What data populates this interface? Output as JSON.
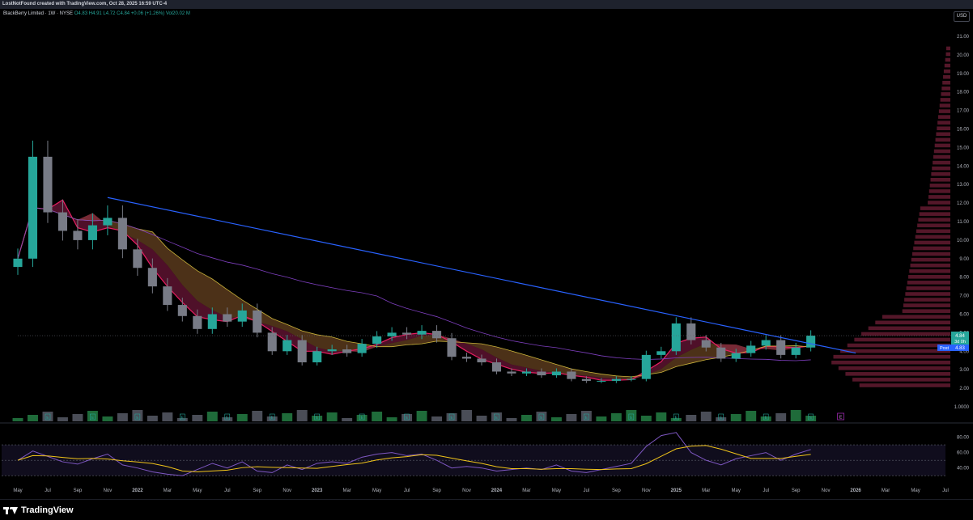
{
  "header": {
    "attribution": "LostNotFound created with TradingView.com, Oct 28, 2025 16:59 UTC-4"
  },
  "legend": {
    "symbol": "BlackBerry Limited · 1W · NYSE",
    "open": "O4.83",
    "high": "H4.91",
    "low": "L4.72",
    "close": "C4.84",
    "change": "+0.06 (+1.26%)",
    "volume": "Vol20.02 M"
  },
  "currency_button": "USD",
  "price_labels": {
    "last": "4.84",
    "countdown": "3d 0h",
    "post_tag": "Post",
    "post_value": "4.83"
  },
  "earnings_marker": "E",
  "brand": {
    "name": "TradingView"
  },
  "colors": {
    "up": "#26a69a",
    "down": "#787b86",
    "trendline": "#2962ff",
    "volume_profile": "#5d1a2e",
    "rsi": "#7e57c2",
    "rsi_ma": "#f0c419"
  },
  "chart_data": [
    {
      "type": "candlestick",
      "title": "BlackBerry Limited · 1W · NYSE",
      "x_ticks": [
        "May",
        "Jul",
        "Sep",
        "Nov",
        "2022",
        "Mar",
        "May",
        "Jul",
        "Sep",
        "Nov",
        "2023",
        "Mar",
        "May",
        "Jul",
        "Sep",
        "Nov",
        "2024",
        "Mar",
        "May",
        "Jul",
        "Sep",
        "Nov",
        "2025",
        "Mar",
        "May",
        "Jul",
        "Sep",
        "Nov",
        "2026",
        "Mar",
        "May",
        "Jul"
      ],
      "y_ticks": [
        "21.00",
        "20.00",
        "19.00",
        "18.00",
        "17.00",
        "16.00",
        "15.00",
        "14.00",
        "13.00",
        "12.00",
        "11.00",
        "10.00",
        "9.00",
        "8.00",
        "7.00",
        "6.00",
        "5.00",
        "4.00",
        "3.00",
        "2.00",
        "1.0000"
      ],
      "ylim": [
        1.0,
        21.0
      ],
      "x": [
        "2021-05",
        "2021-06",
        "2021-07",
        "2021-08",
        "2021-09",
        "2021-10",
        "2021-11",
        "2021-12",
        "2022-01",
        "2022-02",
        "2022-03",
        "2022-04",
        "2022-05",
        "2022-06",
        "2022-07",
        "2022-08",
        "2022-09",
        "2022-10",
        "2022-11",
        "2022-12",
        "2023-01",
        "2023-02",
        "2023-03",
        "2023-04",
        "2023-05",
        "2023-06",
        "2023-07",
        "2023-08",
        "2023-09",
        "2023-10",
        "2023-11",
        "2023-12",
        "2024-01",
        "2024-02",
        "2024-03",
        "2024-04",
        "2024-05",
        "2024-06",
        "2024-07",
        "2024-08",
        "2024-09",
        "2024-10",
        "2024-11",
        "2024-12",
        "2025-01",
        "2025-02",
        "2025-03",
        "2025-04",
        "2025-05",
        "2025-06",
        "2025-07",
        "2025-08",
        "2025-09",
        "2025-10"
      ],
      "close": [
        9.0,
        14.5,
        11.5,
        10.5,
        10.0,
        10.8,
        11.2,
        9.5,
        8.5,
        7.5,
        6.5,
        5.9,
        5.2,
        6.0,
        5.6,
        6.2,
        5.0,
        4.0,
        4.6,
        3.4,
        4.0,
        4.1,
        3.9,
        4.4,
        4.8,
        5.0,
        4.9,
        5.1,
        4.7,
        3.7,
        3.6,
        3.4,
        2.9,
        2.8,
        2.9,
        2.7,
        2.9,
        2.5,
        2.4,
        2.4,
        2.5,
        2.5,
        3.8,
        4.0,
        5.5,
        4.6,
        4.2,
        3.6,
        3.9,
        4.3,
        4.6,
        3.8,
        4.2,
        4.84
      ],
      "trendlines": [
        {
          "from": [
            "2021-11",
            12.3
          ],
          "to": [
            "2026-01",
            3.9
          ]
        }
      ],
      "volume_profile_range": [
        2.0,
        20.5
      ],
      "grid": false
    },
    {
      "type": "line",
      "title": "RSI",
      "y_ticks": [
        "80.00",
        "60.00",
        "40.00"
      ],
      "ylim": [
        25,
        90
      ],
      "bands": [
        70,
        50,
        30
      ],
      "series": [
        {
          "values": [
            50,
            62,
            55,
            48,
            45,
            52,
            58,
            44,
            40,
            35,
            32,
            30,
            38,
            46,
            40,
            48,
            36,
            34,
            44,
            38,
            46,
            48,
            46,
            54,
            58,
            60,
            56,
            58,
            50,
            40,
            42,
            40,
            36,
            38,
            40,
            38,
            44,
            36,
            34,
            38,
            42,
            46,
            68,
            82,
            86,
            60,
            50,
            44,
            52,
            56,
            60,
            50,
            58,
            64
          ]
        }
      ]
    }
  ]
}
